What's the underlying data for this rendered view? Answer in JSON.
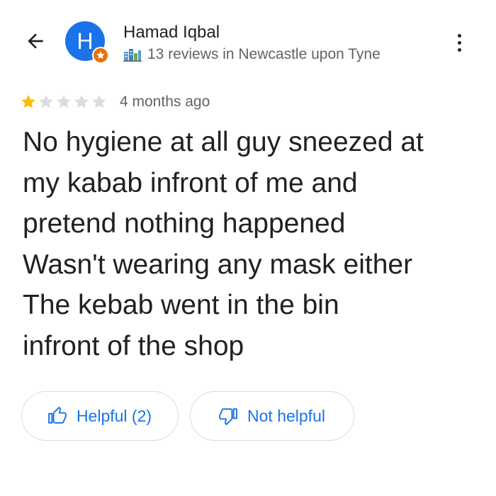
{
  "header": {
    "back_icon": "arrow-back-icon",
    "avatar_initial": "H",
    "avatar_color": "#1a73e8",
    "badge_icon": "local-guide-badge-icon",
    "badge_color": "#e8710a",
    "reviewer_name": "Hamad Iqbal",
    "reviewer_meta_icon": "local-guide-city-icon",
    "reviewer_meta": "13 reviews in Newcastle upon Tyne",
    "more_icon": "more-vert-icon"
  },
  "review": {
    "rating": 1,
    "rating_max": 5,
    "star_filled_color": "#fbbc04",
    "star_empty_color": "#dadce0",
    "time_ago": "4 months ago",
    "text_lines": [
      "No hygiene at all guy sneezed at",
      "my kabab infront of me and",
      "pretend nothing happened",
      "Wasn't wearing any mask either",
      "The kebab went in the bin",
      "infront of the shop"
    ]
  },
  "actions": {
    "helpful_icon": "thumb-up-icon",
    "helpful_label": "Helpful (2)",
    "not_helpful_icon": "thumb-down-icon",
    "not_helpful_label": "Not helpful",
    "accent_color": "#1a73e8"
  }
}
